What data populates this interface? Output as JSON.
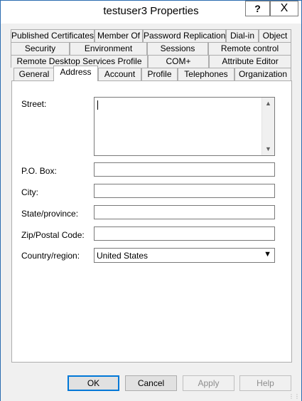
{
  "window": {
    "title": "testuser3 Properties",
    "help_glyph": "?",
    "close_glyph": "X"
  },
  "tabs": {
    "row1": [
      "Published Certificates",
      "Member Of",
      "Password Replication",
      "Dial-in",
      "Object"
    ],
    "row2": [
      "Security",
      "Environment",
      "Sessions",
      "Remote control"
    ],
    "row3": [
      "Remote Desktop Services Profile",
      "COM+",
      "Attribute Editor"
    ],
    "row4": [
      "General",
      "Address",
      "Account",
      "Profile",
      "Telephones",
      "Organization"
    ],
    "active": "Address"
  },
  "form": {
    "street": {
      "label": "Street:",
      "value": ""
    },
    "po_box": {
      "label": "P.O. Box:",
      "value": ""
    },
    "city": {
      "label": "City:",
      "value": ""
    },
    "state": {
      "label": "State/province:",
      "value": ""
    },
    "zip": {
      "label": "Zip/Postal Code:",
      "value": ""
    },
    "country": {
      "label": "Country/region:",
      "value": "United States"
    }
  },
  "buttons": {
    "ok": "OK",
    "cancel": "Cancel",
    "apply": "Apply",
    "help": "Help"
  }
}
